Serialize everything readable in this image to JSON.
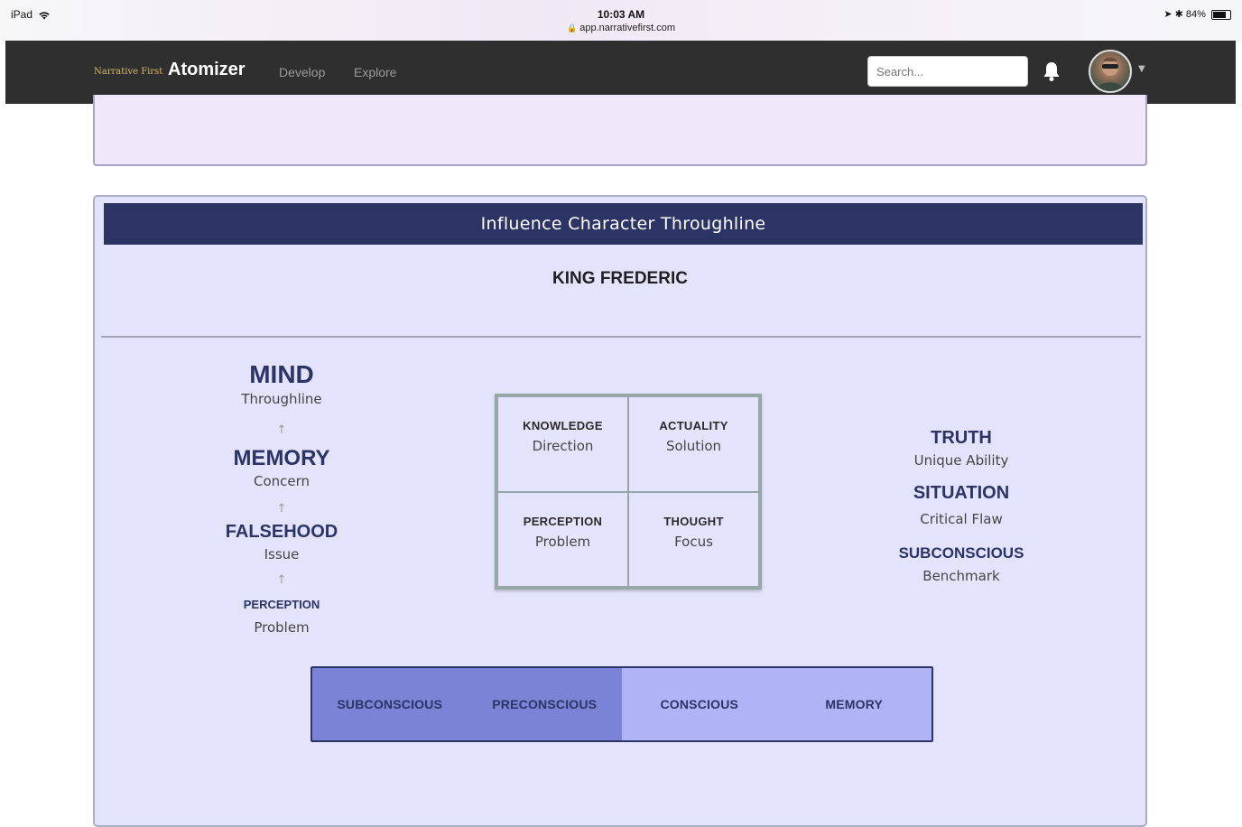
{
  "status_bar": {
    "device": "iPad",
    "time": "10:03 AM",
    "url": "app.narrativefirst.com",
    "battery": "84%",
    "battery_level": 0.84
  },
  "navbar": {
    "brand_small": "Narrative First",
    "brand_big": "Atomizer",
    "links": [
      "Develop",
      "Explore"
    ],
    "search_placeholder": "Search...",
    "colors": {
      "bar": "#2f2f2f",
      "brand_small": "#d7b86a"
    }
  },
  "panel": {
    "header": "Influence Character Throughline",
    "character": "KING FREDERIC",
    "colors": {
      "header_bg": "#2c3466",
      "panel_bg": "#e3e4fb"
    }
  },
  "left_column": [
    {
      "name": "MIND",
      "sub": "Throughline"
    },
    {
      "name": "MEMORY",
      "sub": "Concern"
    },
    {
      "name": "FALSEHOOD",
      "sub": "Issue"
    },
    {
      "name": "PERCEPTION",
      "sub": "Problem"
    }
  ],
  "arrow_glyph": "↑",
  "quad": [
    {
      "name": "KNOWLEDGE",
      "sub": "Direction"
    },
    {
      "name": "ACTUALITY",
      "sub": "Solution"
    },
    {
      "name": "PERCEPTION",
      "sub": "Problem"
    },
    {
      "name": "THOUGHT",
      "sub": "Focus"
    }
  ],
  "right_column": [
    {
      "name": "TRUTH",
      "sub": "Unique Ability"
    },
    {
      "name": "SITUATION",
      "sub": "Critical Flaw"
    },
    {
      "name": "SUBCONSCIOUS",
      "sub": "Benchmark"
    }
  ],
  "bar": {
    "segments": [
      "SUBCONSCIOUS",
      "PRECONSCIOUS",
      "CONSCIOUS",
      "MEMORY"
    ],
    "colors": [
      "#7a83d6",
      "#7a83d6",
      "#b0b4f7",
      "#b0b4f7"
    ]
  }
}
